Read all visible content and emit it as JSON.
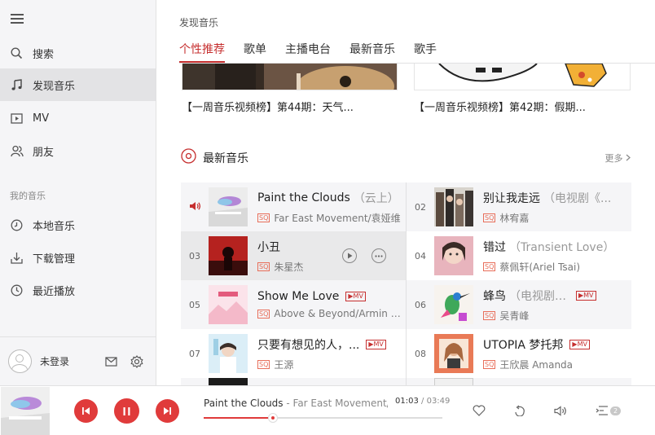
{
  "sidebar": {
    "items": [
      {
        "label": "搜索",
        "icon": "search-icon"
      },
      {
        "label": "发现音乐",
        "icon": "music-note-icon"
      },
      {
        "label": "MV",
        "icon": "video-icon"
      },
      {
        "label": "朋友",
        "icon": "friends-icon"
      }
    ],
    "section_title": "我的音乐",
    "my_music": [
      {
        "label": "本地音乐",
        "icon": "local-music-icon"
      },
      {
        "label": "下载管理",
        "icon": "download-icon"
      },
      {
        "label": "最近播放",
        "icon": "clock-icon"
      }
    ],
    "login_label": "未登录"
  },
  "main": {
    "breadcrumb": "发现音乐",
    "tabs": [
      "个性推荐",
      "歌单",
      "主播电台",
      "最新音乐",
      "歌手"
    ],
    "videos": [
      {
        "title": "【一周音乐视频榜】第44期：天气..."
      },
      {
        "title": "【一周音乐视频榜】第42期：假期..."
      }
    ],
    "section_title": "最新音乐",
    "more_label": "更多",
    "songs": [
      {
        "num": "",
        "title": "Paint the Clouds",
        "alias": "（云上）",
        "artist": "Far East Movement/袁娅维",
        "mv": false,
        "sq": "SQ"
      },
      {
        "num": "02",
        "title": "别让我走远",
        "alias": "（电视剧《...",
        "artist": "林宥嘉",
        "mv": false,
        "sq": "SQ"
      },
      {
        "num": "03",
        "title": "小丑",
        "alias": "",
        "artist": "朱星杰",
        "mv": false,
        "sq": "SQ"
      },
      {
        "num": "04",
        "title": "错过",
        "alias": "（Transient Love）",
        "artist": "蔡佩轩(Ariel Tsai)",
        "mv": false,
        "sq": "SQ"
      },
      {
        "num": "05",
        "title": "Show Me Love",
        "alias": "",
        "artist": "Above & Beyond/Armin va...",
        "mv": true,
        "sq": "SQ"
      },
      {
        "num": "06",
        "title": "蜂鸟",
        "alias": "（电视剧《我...",
        "artist": "吴青峰",
        "mv": true,
        "sq": "SQ"
      },
      {
        "num": "07",
        "title": "只要有想见的人，...",
        "alias": "",
        "artist": "王源",
        "mv": true,
        "sq": "SQ"
      },
      {
        "num": "08",
        "title": "UTOPIA 梦托邦",
        "alias": "",
        "artist": "王欣晨 Amanda",
        "mv": true,
        "sq": "SQ"
      }
    ],
    "mv_label": "▶MV"
  },
  "player": {
    "title": "Paint the Clouds",
    "artist": "- Far East Movement/袁娅",
    "current_time": "01:03",
    "separator": "/",
    "total_time": "03:49",
    "progress": 0.29,
    "playlist_count": "2"
  },
  "colors": {
    "accent": "#c62f2f",
    "play_button": "#e03b3b"
  }
}
